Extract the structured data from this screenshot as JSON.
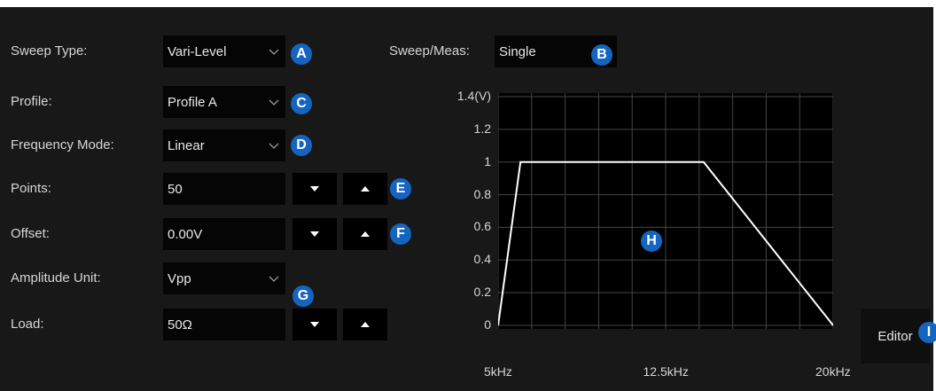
{
  "form": {
    "sweep_type": {
      "label": "Sweep Type:",
      "value": "Vari-Level"
    },
    "profile": {
      "label": "Profile:",
      "value": "Profile A"
    },
    "frequency_mode": {
      "label": "Frequency Mode:",
      "value": "Linear"
    },
    "points": {
      "label": "Points:",
      "value": "50"
    },
    "offset": {
      "label": "Offset:",
      "value": "0.00V"
    },
    "amplitude_unit": {
      "label": "Amplitude Unit:",
      "value": "Vpp"
    },
    "load": {
      "label": "Load:",
      "value": "50Ω"
    }
  },
  "sweep_meas": {
    "label": "Sweep/Meas:",
    "value": "Single"
  },
  "editor": {
    "label": "Editor"
  },
  "badges": {
    "a": "A",
    "b": "B",
    "c": "C",
    "d": "D",
    "e": "E",
    "f": "F",
    "g": "G",
    "h": "H",
    "i": "I"
  },
  "icons": {
    "dropdown": "chevron-down-icon",
    "decrement": "triangle-down-icon",
    "increment": "triangle-up-icon"
  },
  "colors": {
    "background": "#181818",
    "field": "#050505",
    "badge": "#1565c0",
    "trace": "#ffffff",
    "grid": "#444444"
  },
  "chart_data": {
    "type": "line",
    "ylabel": "(V)",
    "y_ticks": [
      "1.4(V)",
      "1.2",
      "1",
      "0.8",
      "0.6",
      "0.4",
      "0.2",
      "0"
    ],
    "x_ticks": [
      "5kHz",
      "12.5kHz",
      "20kHz"
    ],
    "ylim": [
      0,
      1.4
    ],
    "xlim": [
      5,
      20
    ],
    "x_unit": "kHz",
    "grid": true,
    "series": [
      {
        "x": [
          5,
          6.0,
          14.2,
          20
        ],
        "y": [
          0,
          1,
          1,
          0
        ]
      }
    ]
  }
}
